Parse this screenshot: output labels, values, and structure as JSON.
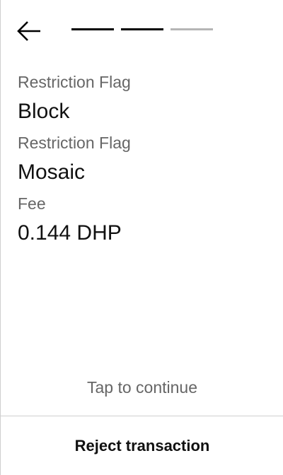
{
  "header": {
    "back_icon": "arrow-left-icon",
    "progress_steps": [
      {
        "state": "complete"
      },
      {
        "state": "complete"
      },
      {
        "state": "incomplete"
      }
    ],
    "progress_completed": 2,
    "progress_total": 3
  },
  "fields": [
    {
      "label": "Restriction Flag",
      "value": "Block"
    },
    {
      "label": "Restriction Flag",
      "value": "Mosaic"
    },
    {
      "label": "Fee",
      "value": "0.144 DHP"
    }
  ],
  "hint": "Tap to continue",
  "footer": {
    "reject_label": "Reject transaction"
  },
  "colors": {
    "active_step": "#000000",
    "inactive_step": "#b5b5b5",
    "label_text": "#666666",
    "value_text": "#111111",
    "divider": "#cfcfcf"
  }
}
